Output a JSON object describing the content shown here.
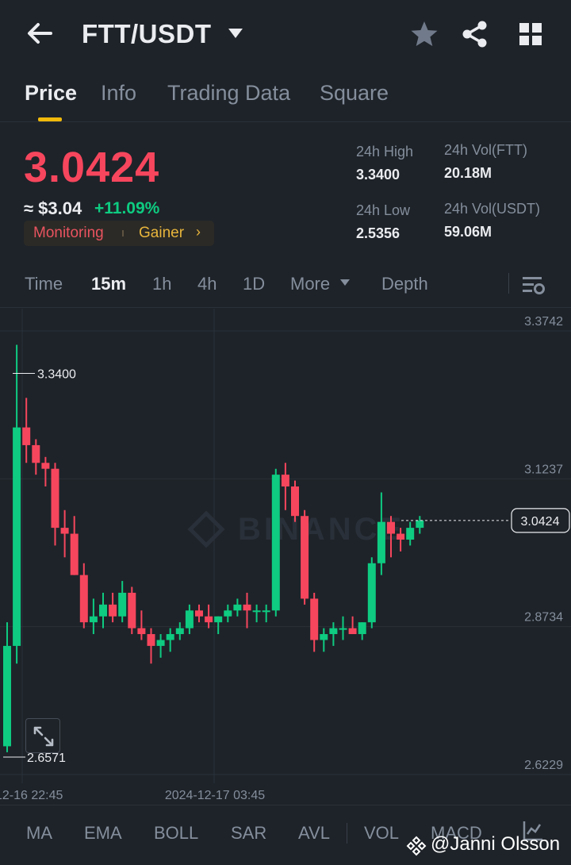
{
  "header": {
    "pair": "FTT/USDT",
    "icons": [
      "back-arrow-icon",
      "caret-down-icon",
      "star-icon",
      "share-icon",
      "grid-icon"
    ]
  },
  "tabs": [
    {
      "label": "Price",
      "active": true
    },
    {
      "label": "Info",
      "active": false
    },
    {
      "label": "Trading Data",
      "active": false
    },
    {
      "label": "Square",
      "active": false
    }
  ],
  "ticker": {
    "last_price": "3.0424",
    "usd_price": "≈ $3.04",
    "change": "+11.09%",
    "tags": {
      "monitoring": "Monitoring",
      "gainer": "Gainer",
      "chevron": "›"
    },
    "stats": {
      "high_label": "24h High",
      "high_value": "3.3400",
      "low_label": "24h Low",
      "low_value": "2.5356",
      "vol_base_label": "24h Vol(FTT)",
      "vol_base_value": "20.18M",
      "vol_quote_label": "24h Vol(USDT)",
      "vol_quote_value": "59.06M"
    },
    "colors": {
      "down": "#f6465d",
      "up": "#0ecb81",
      "accent": "#f0b90b"
    }
  },
  "intervals": {
    "items": [
      "Time",
      "15m",
      "1h",
      "4h",
      "1D"
    ],
    "active": "15m",
    "more": "More",
    "depth": "Depth"
  },
  "chart_data": {
    "type": "candlestick",
    "y_ticks": [
      "3.3742",
      "3.1237",
      "2.8734",
      "2.6229"
    ],
    "ylim": [
      2.6229,
      3.3742
    ],
    "x_ticks": [
      "12-16 22:45",
      "2024-12-17 03:45"
    ],
    "max_label": "3.3400",
    "min_label": "2.6571",
    "current_price_label": "3.0424",
    "watermark": "BINANCE",
    "candles": [
      {
        "o": 2.66,
        "h": 2.87,
        "l": 2.65,
        "c": 2.83
      },
      {
        "o": 2.83,
        "h": 3.34,
        "l": 2.8,
        "c": 3.2
      },
      {
        "o": 3.2,
        "h": 3.25,
        "l": 3.14,
        "c": 3.17
      },
      {
        "o": 3.17,
        "h": 3.18,
        "l": 3.12,
        "c": 3.14
      },
      {
        "o": 3.14,
        "h": 3.15,
        "l": 3.1,
        "c": 3.13
      },
      {
        "o": 3.13,
        "h": 3.14,
        "l": 3.0,
        "c": 3.03
      },
      {
        "o": 3.03,
        "h": 3.06,
        "l": 2.98,
        "c": 3.02
      },
      {
        "o": 3.02,
        "h": 3.05,
        "l": 2.95,
        "c": 2.95
      },
      {
        "o": 2.95,
        "h": 2.97,
        "l": 2.86,
        "c": 2.87
      },
      {
        "o": 2.87,
        "h": 2.91,
        "l": 2.85,
        "c": 2.88
      },
      {
        "o": 2.88,
        "h": 2.92,
        "l": 2.86,
        "c": 2.9
      },
      {
        "o": 2.9,
        "h": 2.92,
        "l": 2.87,
        "c": 2.88
      },
      {
        "o": 2.88,
        "h": 2.94,
        "l": 2.87,
        "c": 2.92
      },
      {
        "o": 2.92,
        "h": 2.93,
        "l": 2.85,
        "c": 2.86
      },
      {
        "o": 2.86,
        "h": 2.89,
        "l": 2.84,
        "c": 2.85
      },
      {
        "o": 2.85,
        "h": 2.86,
        "l": 2.8,
        "c": 2.83
      },
      {
        "o": 2.83,
        "h": 2.85,
        "l": 2.81,
        "c": 2.84
      },
      {
        "o": 2.84,
        "h": 2.86,
        "l": 2.82,
        "c": 2.85
      },
      {
        "o": 2.85,
        "h": 2.87,
        "l": 2.84,
        "c": 2.86
      },
      {
        "o": 2.86,
        "h": 2.9,
        "l": 2.85,
        "c": 2.89
      },
      {
        "o": 2.89,
        "h": 2.9,
        "l": 2.87,
        "c": 2.88
      },
      {
        "o": 2.88,
        "h": 2.9,
        "l": 2.86,
        "c": 2.87
      },
      {
        "o": 2.87,
        "h": 2.88,
        "l": 2.85,
        "c": 2.88
      },
      {
        "o": 2.88,
        "h": 2.9,
        "l": 2.87,
        "c": 2.89
      },
      {
        "o": 2.89,
        "h": 2.91,
        "l": 2.88,
        "c": 2.9
      },
      {
        "o": 2.9,
        "h": 2.92,
        "l": 2.86,
        "c": 2.89
      },
      {
        "o": 2.89,
        "h": 2.9,
        "l": 2.87,
        "c": 2.89
      },
      {
        "o": 2.89,
        "h": 2.9,
        "l": 2.87,
        "c": 2.89
      },
      {
        "o": 2.89,
        "h": 3.13,
        "l": 2.88,
        "c": 3.12
      },
      {
        "o": 3.12,
        "h": 3.14,
        "l": 3.06,
        "c": 3.1
      },
      {
        "o": 3.1,
        "h": 3.11,
        "l": 3.04,
        "c": 3.05
      },
      {
        "o": 3.05,
        "h": 3.06,
        "l": 2.9,
        "c": 2.91
      },
      {
        "o": 2.91,
        "h": 2.92,
        "l": 2.82,
        "c": 2.84
      },
      {
        "o": 2.84,
        "h": 2.86,
        "l": 2.82,
        "c": 2.85
      },
      {
        "o": 2.85,
        "h": 2.87,
        "l": 2.83,
        "c": 2.86
      },
      {
        "o": 2.86,
        "h": 2.88,
        "l": 2.84,
        "c": 2.86
      },
      {
        "o": 2.86,
        "h": 2.88,
        "l": 2.85,
        "c": 2.85
      },
      {
        "o": 2.85,
        "h": 2.87,
        "l": 2.84,
        "c": 2.87
      },
      {
        "o": 2.87,
        "h": 2.98,
        "l": 2.86,
        "c": 2.97
      },
      {
        "o": 2.97,
        "h": 3.09,
        "l": 2.95,
        "c": 3.04
      },
      {
        "o": 3.04,
        "h": 3.05,
        "l": 2.98,
        "c": 3.02
      },
      {
        "o": 3.02,
        "h": 3.03,
        "l": 2.99,
        "c": 3.01
      },
      {
        "o": 3.01,
        "h": 3.04,
        "l": 3.0,
        "c": 3.03
      },
      {
        "o": 3.03,
        "h": 3.05,
        "l": 3.02,
        "c": 3.0424
      }
    ]
  },
  "indicators": {
    "items": [
      "MA",
      "EMA",
      "BOLL",
      "SAR",
      "AVL",
      "VOL",
      "MACD"
    ]
  },
  "watermark": {
    "user": "@Janni Olsson"
  }
}
